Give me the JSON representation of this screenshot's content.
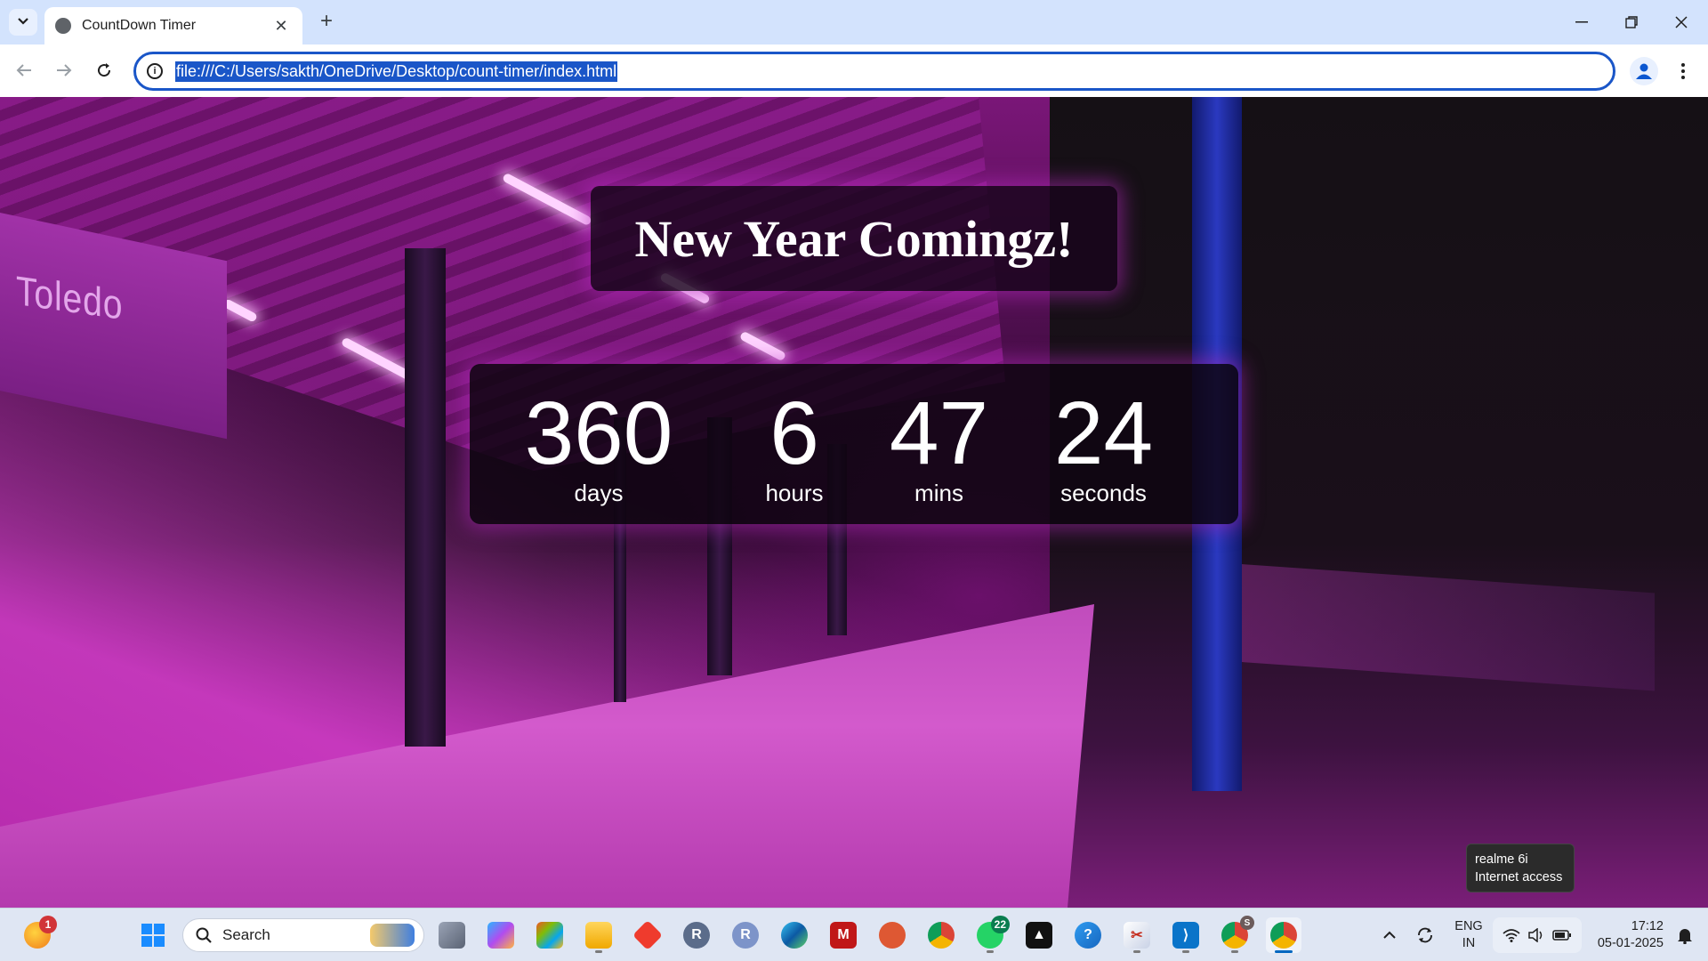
{
  "browser": {
    "tab_title": "CountDown Timer",
    "url": "file:///C:/Users/sakth/OneDrive/Desktop/count-timer/index.html",
    "new_tab_label": "+"
  },
  "page": {
    "station_sign": "Toledo",
    "title": "New Year Comingz!",
    "countdown": [
      {
        "value": "360",
        "label": "days"
      },
      {
        "value": "6",
        "label": "hours"
      },
      {
        "value": "47",
        "label": "mins"
      },
      {
        "value": "24",
        "label": "seconds"
      }
    ]
  },
  "tooltip": {
    "line1": "realme 6i",
    "line2": "Internet access"
  },
  "taskbar": {
    "search_label": "Search",
    "widgets_badge": "1",
    "whatsapp_badge": "22",
    "chrome_profile_badge": "S",
    "language": "ENG",
    "region": "IN",
    "time": "17:12",
    "date": "05-01-2025"
  },
  "colors": {
    "accent": "#1a56c8",
    "glow": "#b428be",
    "taskbar": "#dfe6f3"
  }
}
